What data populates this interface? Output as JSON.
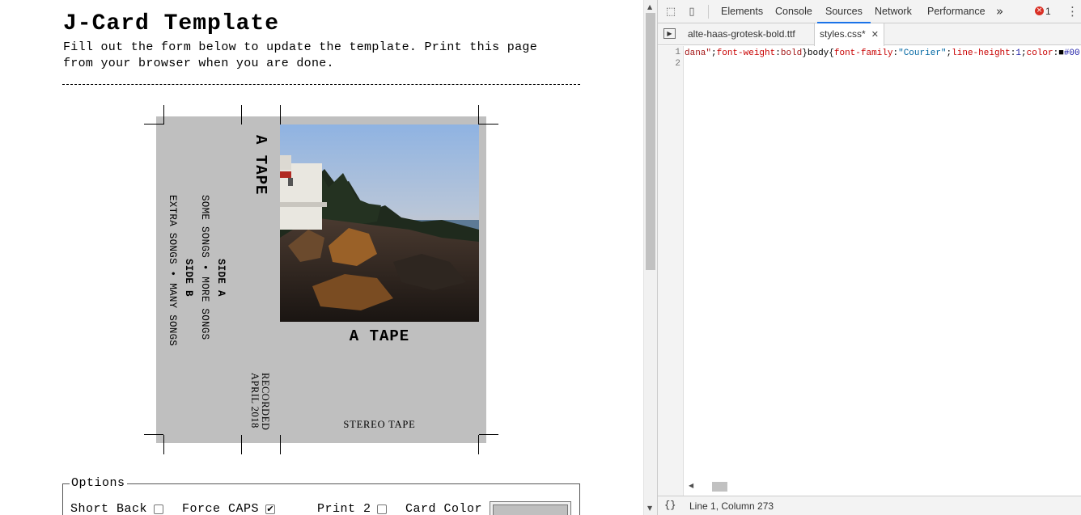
{
  "page": {
    "title": "J-Card Template",
    "intro_line1": "Fill out the form below to update the template. Print this page",
    "intro_line2": "from your browser when you are done."
  },
  "jcard": {
    "card_color": "#bfbfbf",
    "spine_title": "A TAPE",
    "recorded_line1": "RECORDED",
    "recorded_line2": "APRIL 2018",
    "side_a_label": "SIDE A",
    "side_a_tracks": "SOME SONGS • MORE SONGS",
    "side_b_label": "SIDE B",
    "side_b_tracks": "EXTRA SONGS • MANY SONGS",
    "front_title": "A TAPE",
    "front_footer": "STEREO TAPE",
    "cover_image": "lighthouse-on-rocky-coast-at-sunset"
  },
  "options": {
    "legend": "Options",
    "short_back_label": "Short Back",
    "short_back_checked": false,
    "force_caps_label": "Force CAPS",
    "force_caps_checked": true,
    "print2_label": "Print 2",
    "print2_checked": false,
    "card_color_label": "Card Color",
    "card_color_value": "#bfbfbf"
  },
  "devtools": {
    "tabs": [
      "Elements",
      "Console",
      "Sources",
      "Network",
      "Performance"
    ],
    "active_tab": "Sources",
    "more_tabs_icon": "»",
    "error_count": "1",
    "files": [
      "alte-haas-grotesk-bold.ttf",
      "styles.css*"
    ],
    "active_file": "styles.css*",
    "line_numbers": [
      "1",
      "2"
    ],
    "code_tokens": [
      {
        "t": "dana\"",
        "c": "#a31515"
      },
      {
        "t": ";",
        "c": "#000000"
      },
      {
        "t": "font-weight",
        "c": "#c80000"
      },
      {
        "t": ":",
        "c": "#000000"
      },
      {
        "t": "bold",
        "c": "#a31515"
      },
      {
        "t": "}body{",
        "c": "#000000"
      },
      {
        "t": "font-family",
        "c": "#c80000"
      },
      {
        "t": ":",
        "c": "#000000"
      },
      {
        "t": "\"Courier\"",
        "c": "#0067a3"
      },
      {
        "t": ";",
        "c": "#000000"
      },
      {
        "t": "line-height",
        "c": "#c80000"
      },
      {
        "t": ":",
        "c": "#000000"
      },
      {
        "t": "1",
        "c": "#1a1aa6"
      },
      {
        "t": ";",
        "c": "#000000"
      },
      {
        "t": "color",
        "c": "#c80000"
      },
      {
        "t": ":",
        "c": "#000000"
      },
      {
        "t": "■",
        "c": "#000000"
      },
      {
        "t": "#00",
        "c": "#1a1aa6"
      }
    ],
    "status_icon": "{}",
    "status_position": "Line 1, Column 273"
  },
  "colors": {
    "devtools_accent": "#1a73e8",
    "error_red": "#d93025",
    "toolbar_bg": "#f3f3f3"
  }
}
